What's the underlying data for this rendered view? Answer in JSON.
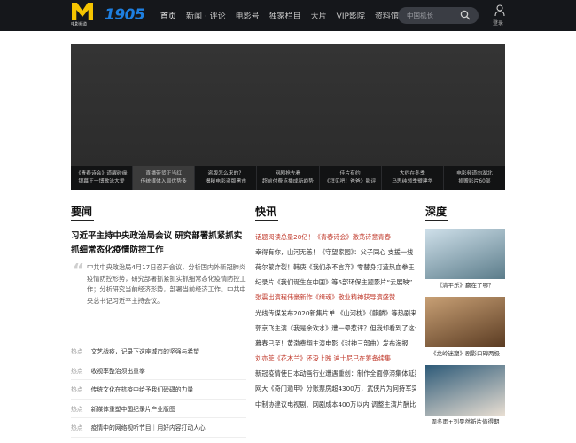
{
  "header": {
    "logo_sub": "电影频道",
    "brand": "1905",
    "nav": [
      "首页",
      "新闻 · 评论",
      "电影号",
      "独家栏目",
      "大片",
      "VIP影院",
      "资料馆"
    ],
    "search_placeholder": "中国机长",
    "login_label": "登录"
  },
  "banner": {
    "thumbs": [
      {
        "line1": "《青春诗会》道醒碰缘",
        "line2": "银幕王一博歌泳大爱"
      },
      {
        "line1": "直播带货正当红",
        "line2": "传统媒体入局优势多"
      },
      {
        "line1": "盗版怎么来的？",
        "line2": "揭秘电影盗版黑市"
      },
      {
        "line1": "网剧抢先看",
        "line2": "超前付费点播成新趋势"
      },
      {
        "line1": "佳片有约",
        "line2": "《拜见吧！爸爸》影评"
      },
      {
        "line1": "大约在冬季",
        "line2": "马思纯领季璧建华"
      },
      {
        "line1": "电影频道向湖北",
        "line2": "捐赠影片60部"
      }
    ]
  },
  "sections": {
    "news_title": "要闻",
    "quick_title": "快讯",
    "depth_title": "深度"
  },
  "news": {
    "lead": "习近平主持中央政治局会议 研究部署抓紧抓实抓细常态化疫情防控工作",
    "summary": "中共中央政治局4月17日召开会议，分析国内外新冠肺炎疫情防控形势，研究部署抓紧抓实抓细常态化疫情防控工作；分析研究当前经济形势，部署当前经济工作。中共中央总书记习近平主持会议。",
    "hot": [
      {
        "tag": "热点",
        "text": "文艺战疫，记录下这座城市的坚强与希望"
      },
      {
        "tag": "热点",
        "text": "收视率整治须出重拳"
      },
      {
        "tag": "热点",
        "text": "传统文化在抗疫中给予我们磅礴的力量"
      },
      {
        "tag": "热点",
        "text": "新媒体重塑中国纪录片产业版图"
      },
      {
        "tag": "热点",
        "text": "疫情中的网络视听节目｜用好内容打动人心"
      }
    ]
  },
  "quick": [
    {
      "text": "话题阅读总量28亿！《青春诗会》激荡诗意青春",
      "hl": true
    },
    {
      "text": "幸得有你，山河无恙！《守望家园》：父子同心 支援一线",
      "hl": false
    },
    {
      "text": "荷尔蒙炸裂！韩庚《我们永不言弃》零替身打造热血拳王",
      "hl": false
    },
    {
      "text": "纪录片《我们诞生在中国》等5部环保主题影片“云展映”",
      "hl": false
    },
    {
      "text": "张震出演程伟豪新作《缉魂》敬业精神获导演盛赞",
      "hl": true
    },
    {
      "text": "光线传媒发布2020新集片单 《山河枕》《麒麟》等热剧来袭",
      "hl": false
    },
    {
      "text": "郭京飞主演《我是余欢水》遭一晕惹评？但我却看到了这个时代",
      "hl": false
    },
    {
      "text": "暮春已至！黄渤费翔主演电影《封神三部曲》发布海报",
      "hl": false
    },
    {
      "text": "刘亦菲《花木兰》还没上映 迪士尼已在筹备续集",
      "hl": true
    },
    {
      "text": "新冠疫情使日本动画行业遭遇重创：制作全面停滞集体延期",
      "hl": false
    },
    {
      "text": "网大《奇门遁甲》分账票房超4300万，武侠片为何持军突围？",
      "hl": false
    },
    {
      "text": "中制协建议电视剧、网剧成本400万以内 调整主演片酬比例",
      "hl": false
    }
  ],
  "depth": [
    {
      "caption": "《清平乐》赢在了哪？",
      "color1": "#cfe0ea",
      "color2": "#5b7c8a"
    },
    {
      "caption": "《龙岭迷窟》剧影口碑两极",
      "color1": "#c8a075",
      "color2": "#5a3b22"
    },
    {
      "caption": "周冬雨+刘昊然新片值得期",
      "color1": "#2d5a78",
      "color2": "#e8ded2"
    }
  ]
}
